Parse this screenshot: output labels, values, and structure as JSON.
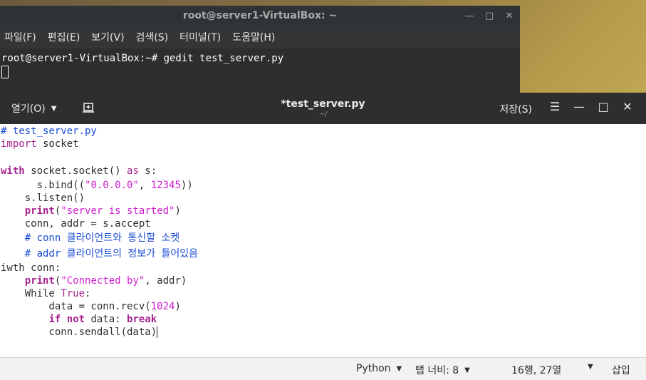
{
  "terminal": {
    "title": "root@server1-VirtualBox: ~",
    "menu": [
      "파일(F)",
      "편집(E)",
      "보기(V)",
      "검색(S)",
      "터미널(T)",
      "도움말(H)"
    ],
    "command_line": "root@server1-VirtualBox:~# gedit test_server.py"
  },
  "gedit": {
    "open_label": "열기(O)",
    "filename": "*test_server.py",
    "path": "~/",
    "save_label": "저장(S)",
    "status": {
      "language": "Python",
      "tab_width": "탭 너비: 8",
      "position": "16행, 27열",
      "insert_mode": "삽입"
    }
  },
  "code": {
    "l1": "# test_server.py",
    "l2_kw": "import",
    "l2_rest": " socket",
    "l4_kw": "with",
    "l4_a": " socket.socket() ",
    "l4_as": "as",
    "l4_b": " s:",
    "l5_a": "      s.bind((",
    "l5_str": "\"0.0.0.0\"",
    "l5_b": ", ",
    "l5_num": "12345",
    "l5_c": "))",
    "l6": "    s.listen()",
    "l7_ind": "    ",
    "l7_kw": "print",
    "l7_a": "(",
    "l7_str": "\"server is started\"",
    "l7_b": ")",
    "l8": "    conn, addr = s.accept",
    "l9_ind": "    ",
    "l9_cm": "# conn 클라이언트와 통신할 소켓",
    "l10_ind": "    ",
    "l10_cm": "# addr 클라이언트의 정보가 들어있음",
    "l11": "iwth conn:",
    "l12_ind": "    ",
    "l12_kw": "print",
    "l12_a": "(",
    "l12_str": "\"Connected by\"",
    "l12_b": ", addr)",
    "l13_a": "    While ",
    "l13_kw": "True",
    "l13_b": ":",
    "l14_a": "        data = conn.recv(",
    "l14_num": "1024",
    "l14_b": ")",
    "l15_ind": "        ",
    "l15_if": "if",
    "l15_sp": " ",
    "l15_not": "not",
    "l15_a": " data: ",
    "l15_brk": "break",
    "l16": "        conn.sendall(data)"
  },
  "colors": {
    "comment": "#1a4bd6",
    "keyword": "#a6238f",
    "string": "#d01fd0",
    "header_bg": "#2c2e30"
  }
}
